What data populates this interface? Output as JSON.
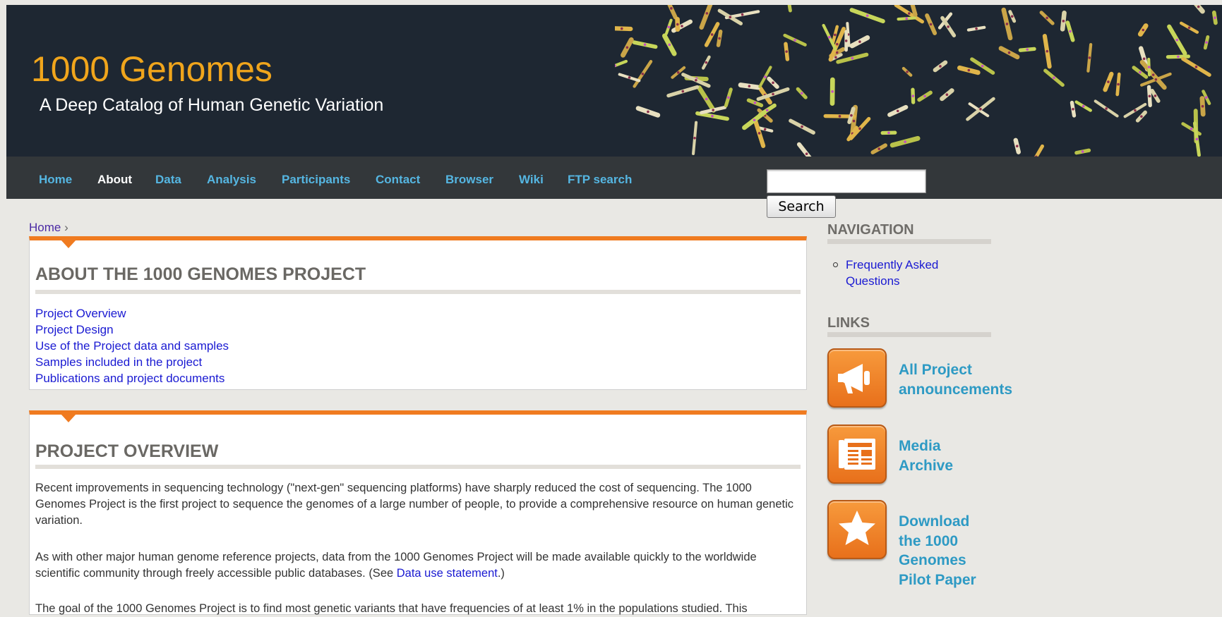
{
  "header": {
    "site_name": "1000 Genomes",
    "slogan": "A Deep Catalog of Human Genetic Variation",
    "background_color": "#1e2732",
    "accent_color": "#f0a51c"
  },
  "nav": {
    "items": [
      {
        "label": "Home"
      },
      {
        "label": "About",
        "active": true
      },
      {
        "label": "Data"
      },
      {
        "label": "Analysis"
      },
      {
        "label": "Participants"
      },
      {
        "label": "Contact"
      },
      {
        "label": "Browser"
      },
      {
        "label": "Wiki"
      },
      {
        "label": "FTP search"
      }
    ],
    "link_color": "#55b6e2"
  },
  "search": {
    "value": "",
    "button_label": "Search"
  },
  "breadcrumb": {
    "home": "Home",
    "separator": "›"
  },
  "about_block": {
    "title": "ABOUT THE 1000 GENOMES PROJECT",
    "links": [
      "Project Overview",
      "Project Design",
      "Use of the Project data and samples",
      "Samples included in the project",
      "Publications and project documents"
    ]
  },
  "overview_block": {
    "title": "PROJECT OVERVIEW",
    "para1": "Recent improvements in sequencing technology (\"next-gen\" sequencing platforms) have sharply reduced the cost of sequencing. The 1000 Genomes Project is the first project to sequence the genomes of a large number of people, to provide a comprehensive resource on human genetic variation.",
    "para2_before": "As with other major human genome reference projects, data from the 1000 Genomes Project will be made available quickly to the worldwide scientific community through freely accessible public databases. (See ",
    "para2_link": "Data use statement",
    "para2_after": ".)",
    "para3": "The goal of the 1000 Genomes Project is to find most genetic variants that have frequencies of at least 1% in the populations studied. This"
  },
  "sidebar": {
    "navigation_title": "NAVIGATION",
    "navigation_items": [
      "Frequently Asked Questions"
    ],
    "links_title": "LINKS",
    "promos": [
      {
        "label": "All Project\nannouncements",
        "icon": "megaphone-icon"
      },
      {
        "label": "Media\nArchive",
        "icon": "newspaper-icon"
      },
      {
        "label": "Download\nthe 1000\nGenomes\nPilot Paper",
        "icon": "star-icon"
      }
    ],
    "promo_color": "#f07b20"
  }
}
